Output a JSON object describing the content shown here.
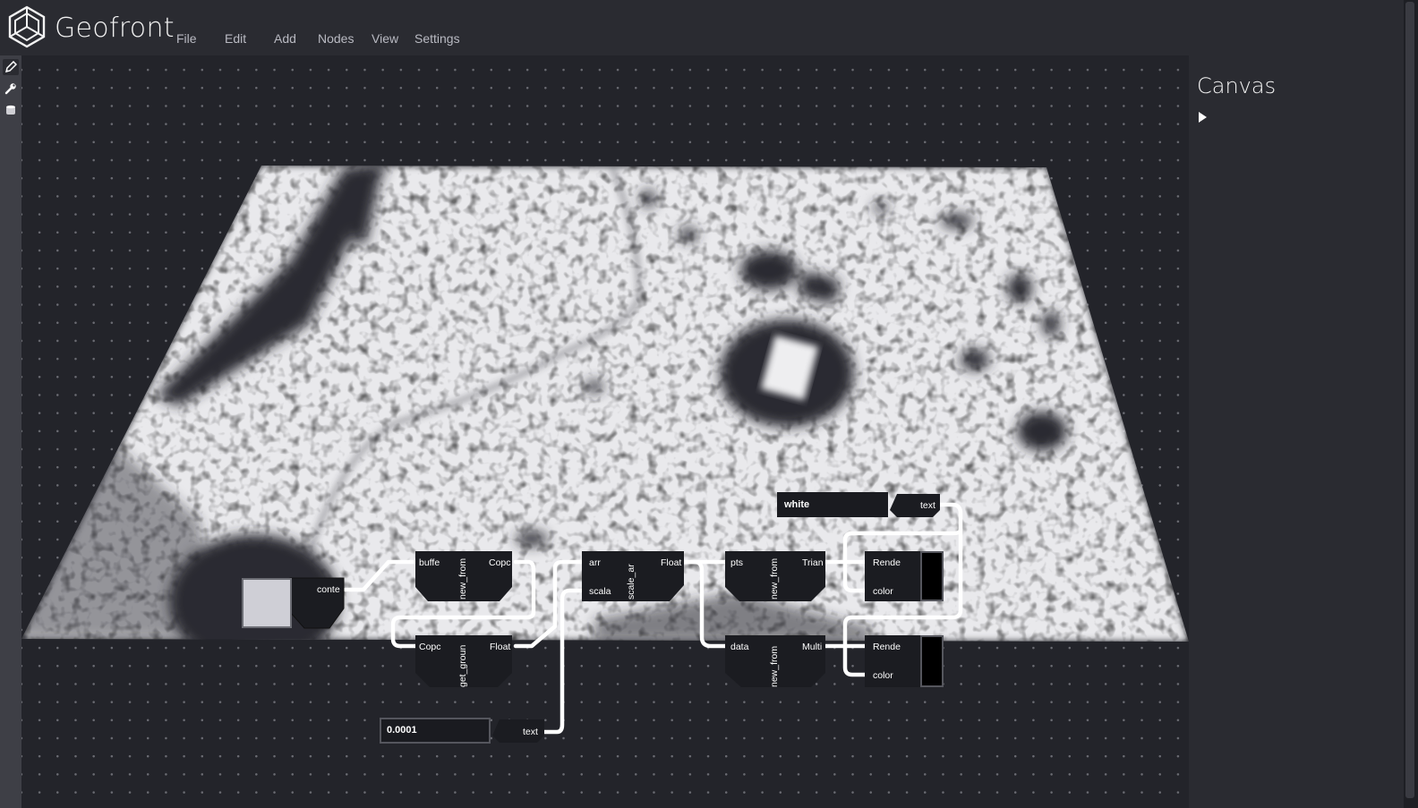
{
  "app": {
    "title": "Geofront"
  },
  "menu": [
    "File",
    "Edit",
    "Add",
    "Nodes",
    "View",
    "Settings"
  ],
  "toolbar": {
    "tools": [
      "pencil-icon",
      "wrench-icon",
      "cylinder-icon"
    ]
  },
  "panel": {
    "title": "Canvas"
  },
  "nodes": {
    "color_input": {
      "port": "conte"
    },
    "buffer_node": {
      "in": "buffe",
      "name": "new_from",
      "out": "Copc"
    },
    "ground_node": {
      "in": "Copc",
      "name": "get_groun",
      "out": "Float"
    },
    "scale_node": {
      "in1": "arr",
      "in2": "scala",
      "name": "scale_ar",
      "out": "Float"
    },
    "number_input": {
      "value": "0.0001",
      "port": "text"
    },
    "tri_node": {
      "in": "pts",
      "name": "new_from",
      "out": "Trian"
    },
    "multi_node": {
      "in": "data",
      "name": "new_from",
      "out": "Multi"
    },
    "text_input": {
      "value": "white",
      "port": "text"
    },
    "render_top": {
      "in1": "Rende",
      "in2": "color"
    },
    "render_bottom": {
      "in1": "Rende",
      "in2": "color"
    }
  }
}
